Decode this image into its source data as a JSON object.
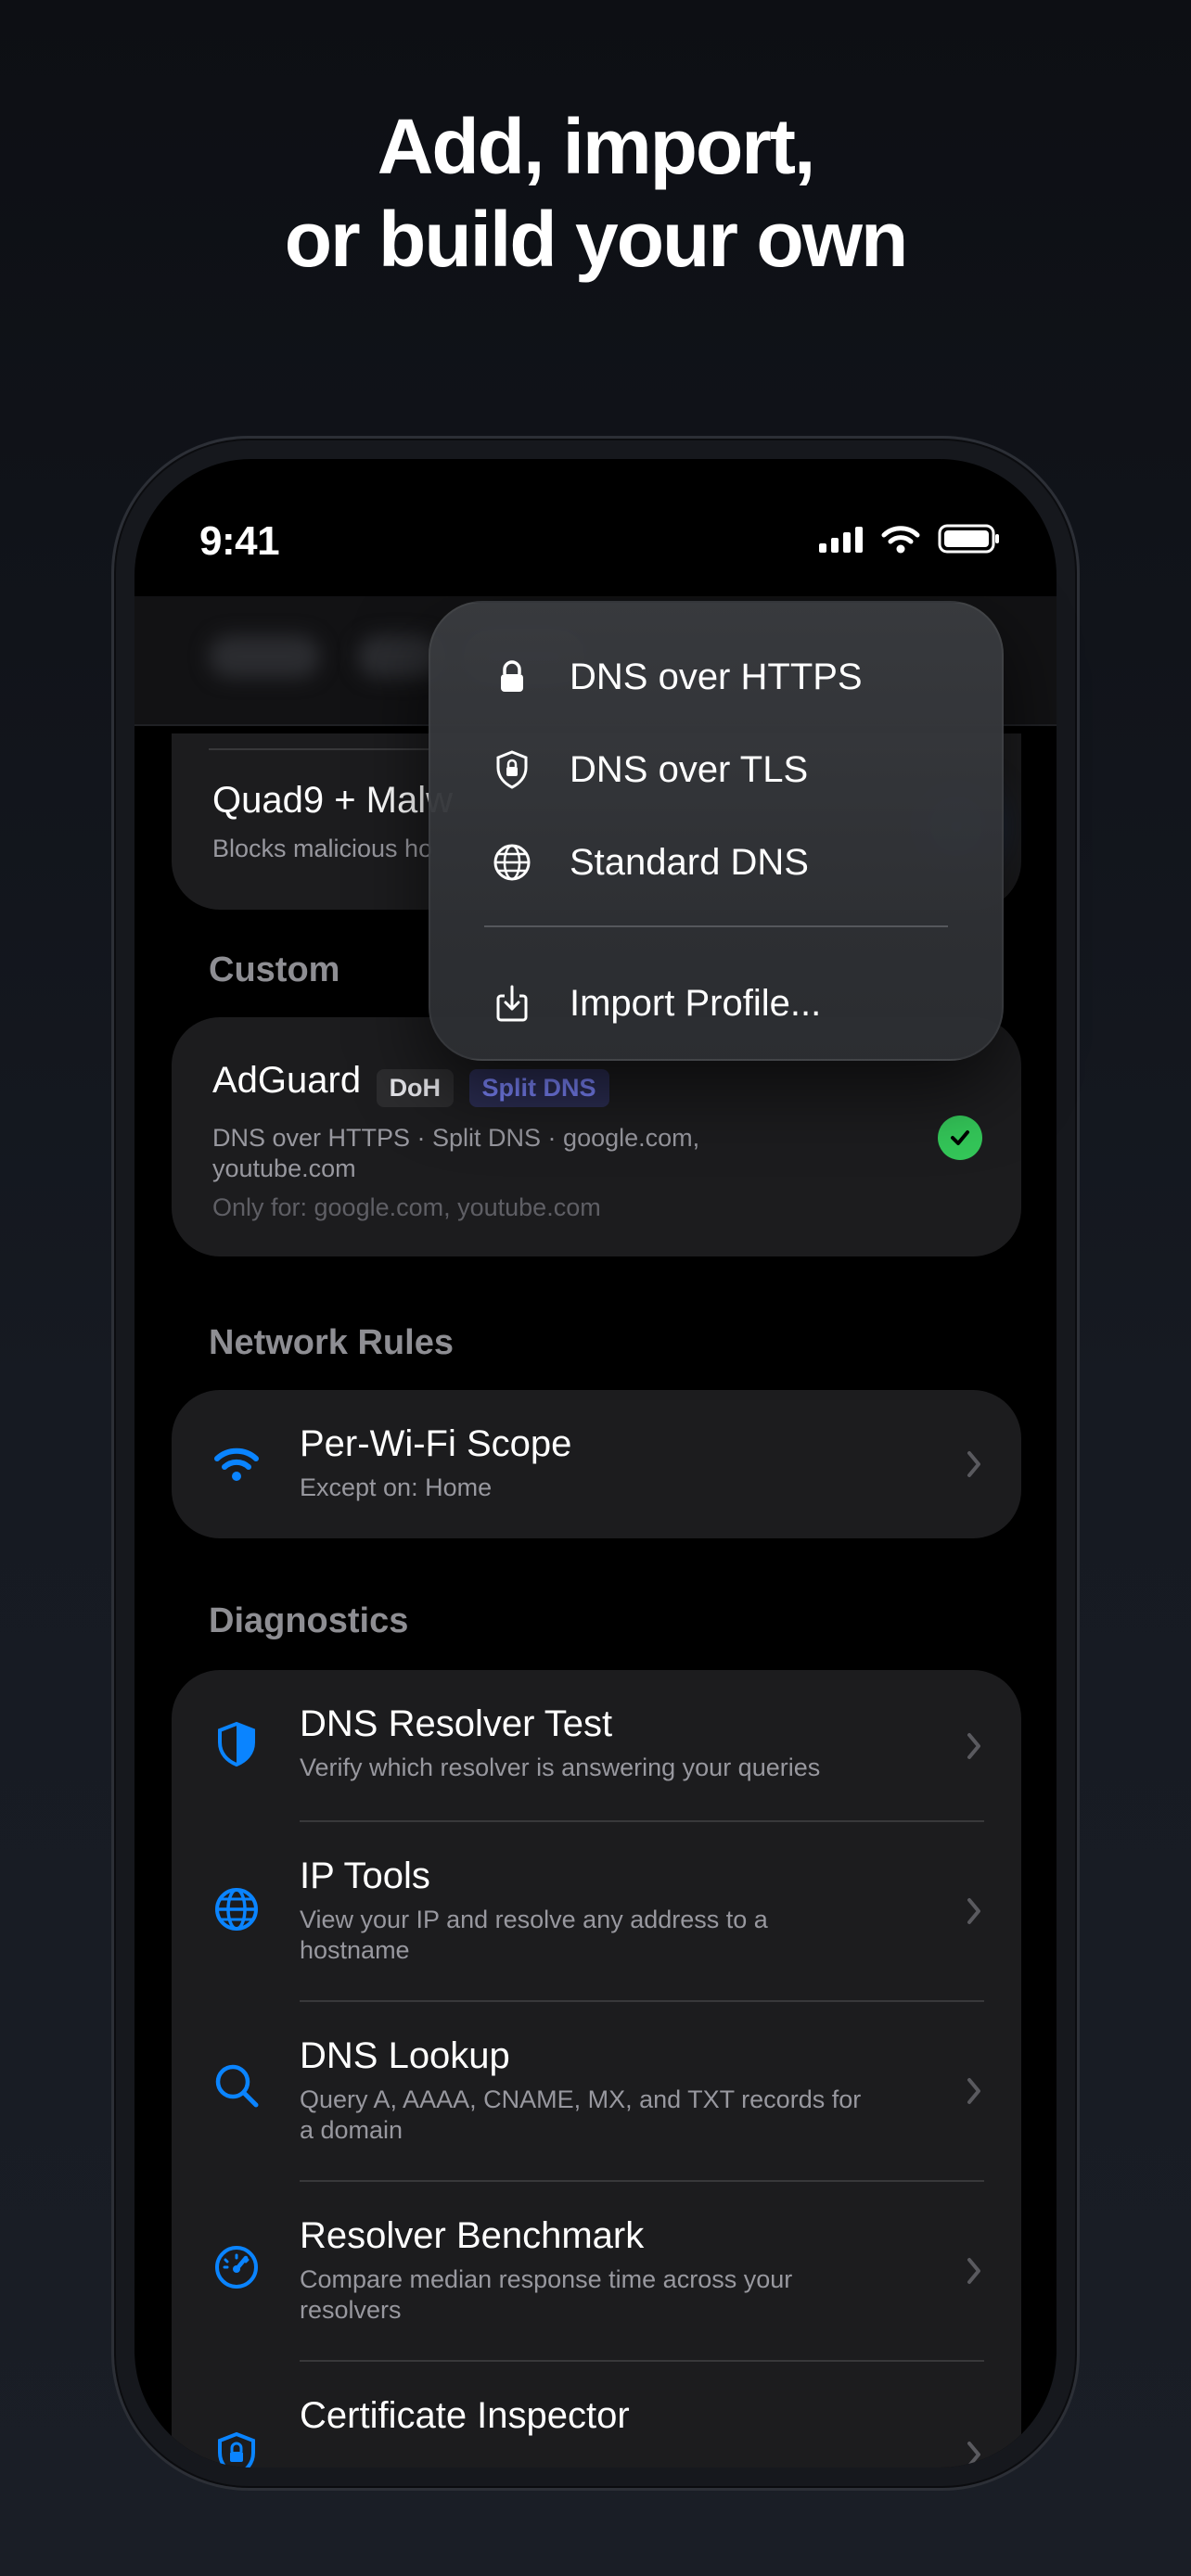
{
  "headline": {
    "line1": "Add, import,",
    "line2": "or build your own"
  },
  "status_bar": {
    "time": "9:41"
  },
  "partial_row": {
    "title": "Quad9 + Malw",
    "subtitle": "Blocks malicious ho"
  },
  "custom": {
    "header": "Custom",
    "item": {
      "title": "AdGuard",
      "badges": [
        "DoH",
        "Split DNS"
      ],
      "subtitle": "DNS over HTTPS · Split DNS · google.com, youtube.com",
      "detail": "Only for: google.com, youtube.com",
      "selected": true
    }
  },
  "network_rules": {
    "header": "Network Rules",
    "item": {
      "title": "Per-Wi-Fi Scope",
      "subtitle": "Except on: Home",
      "icon": "wifi-icon"
    }
  },
  "diagnostics": {
    "header": "Diagnostics",
    "items": [
      {
        "title": "DNS Resolver Test",
        "subtitle": "Verify which resolver is answering your queries",
        "icon": "shield-icon"
      },
      {
        "title": "IP Tools",
        "subtitle": "View your IP and resolve any address to a hostname",
        "icon": "globe-icon"
      },
      {
        "title": "DNS Lookup",
        "subtitle": "Query A, AAAA, CNAME, MX, and TXT records for a domain",
        "icon": "search-icon"
      },
      {
        "title": "Resolver Benchmark",
        "subtitle": "Compare median response time across your resolvers",
        "icon": "speedometer-icon"
      },
      {
        "title": "Certificate Inspector",
        "subtitle": "",
        "icon": "lock-shield-icon"
      }
    ]
  },
  "menu": {
    "items": [
      {
        "label": "DNS over HTTPS",
        "icon": "lock-icon"
      },
      {
        "label": "DNS over TLS",
        "icon": "shield-lock-icon"
      },
      {
        "label": "Standard DNS",
        "icon": "globe-icon"
      },
      {
        "label": "Import Profile...",
        "icon": "import-icon"
      }
    ]
  },
  "colors": {
    "accent_blue": "#0a84ff",
    "check_green": "#34c759",
    "split_badge": "#7d86ff"
  }
}
